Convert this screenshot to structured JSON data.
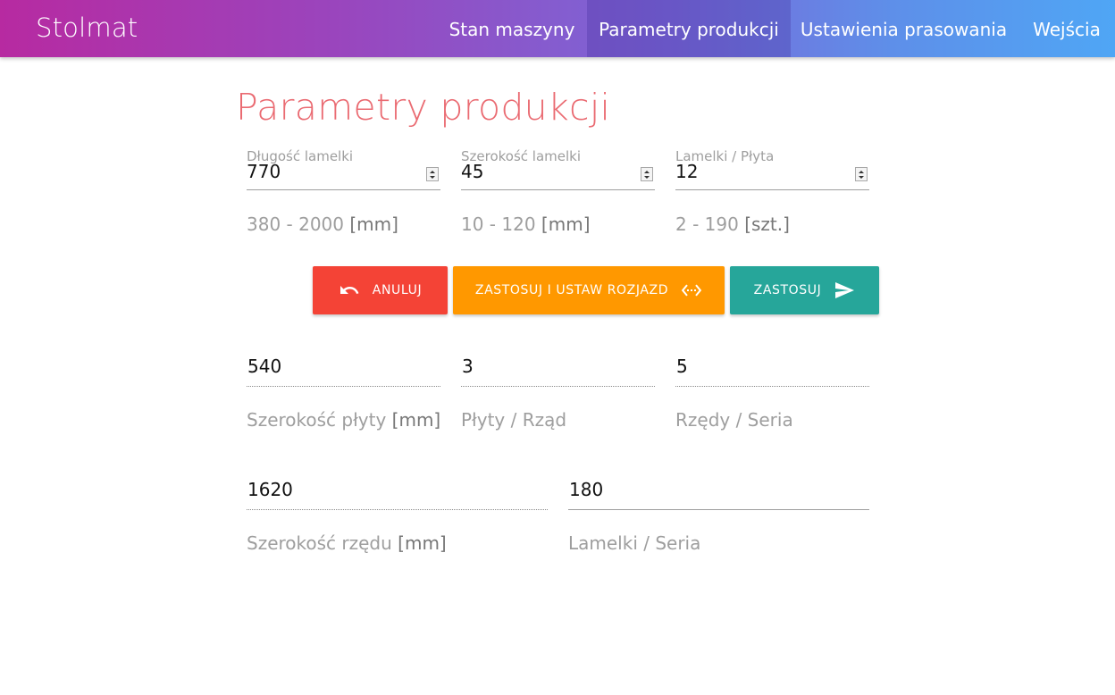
{
  "app": {
    "brand": "Stolmat"
  },
  "nav": {
    "items": [
      {
        "label": "Stan maszyny"
      },
      {
        "label": "Parametry produkcji"
      },
      {
        "label": "Ustawienia prasowania"
      },
      {
        "label": "Wejścia"
      }
    ],
    "active_index": 1
  },
  "page": {
    "title": "Parametry produkcji"
  },
  "inputs": [
    {
      "label": "Długość lamelki",
      "value": "770",
      "range": "380 - 2000",
      "unit": "[mm]"
    },
    {
      "label": "Szerokość lamelki",
      "value": "45",
      "range": "10 - 120",
      "unit": "[mm]"
    },
    {
      "label": "Lamelki / Płyta",
      "value": "12",
      "range": "2 - 190",
      "unit": "[szt.]"
    }
  ],
  "buttons": {
    "cancel": {
      "label": "ANULUJ",
      "icon": "undo-icon",
      "color": "#f44336"
    },
    "apply_set": {
      "label": "ZASTOSUJ I USTAW ROZJAZD",
      "icon": "code-arrows-icon",
      "color": "#ff9800"
    },
    "apply": {
      "label": "ZASTOSUJ",
      "icon": "send-icon",
      "color": "#26a69a"
    }
  },
  "outputs": [
    {
      "value": "540",
      "label": "Szerokość płyty",
      "unit": "[mm]"
    },
    {
      "value": "3",
      "label": "Płyty / Rząd",
      "unit": ""
    },
    {
      "value": "5",
      "label": "Rzędy / Seria",
      "unit": ""
    },
    {
      "value": "1620",
      "label": "Szerokość rzędu",
      "unit": "[mm]"
    },
    {
      "value": "180",
      "label": "Lamelki / Seria",
      "unit": ""
    }
  ],
  "colors": {
    "title": "#ea6b72",
    "header_gradient_start": "#b72aa1",
    "header_gradient_end": "#4fa6f5"
  }
}
